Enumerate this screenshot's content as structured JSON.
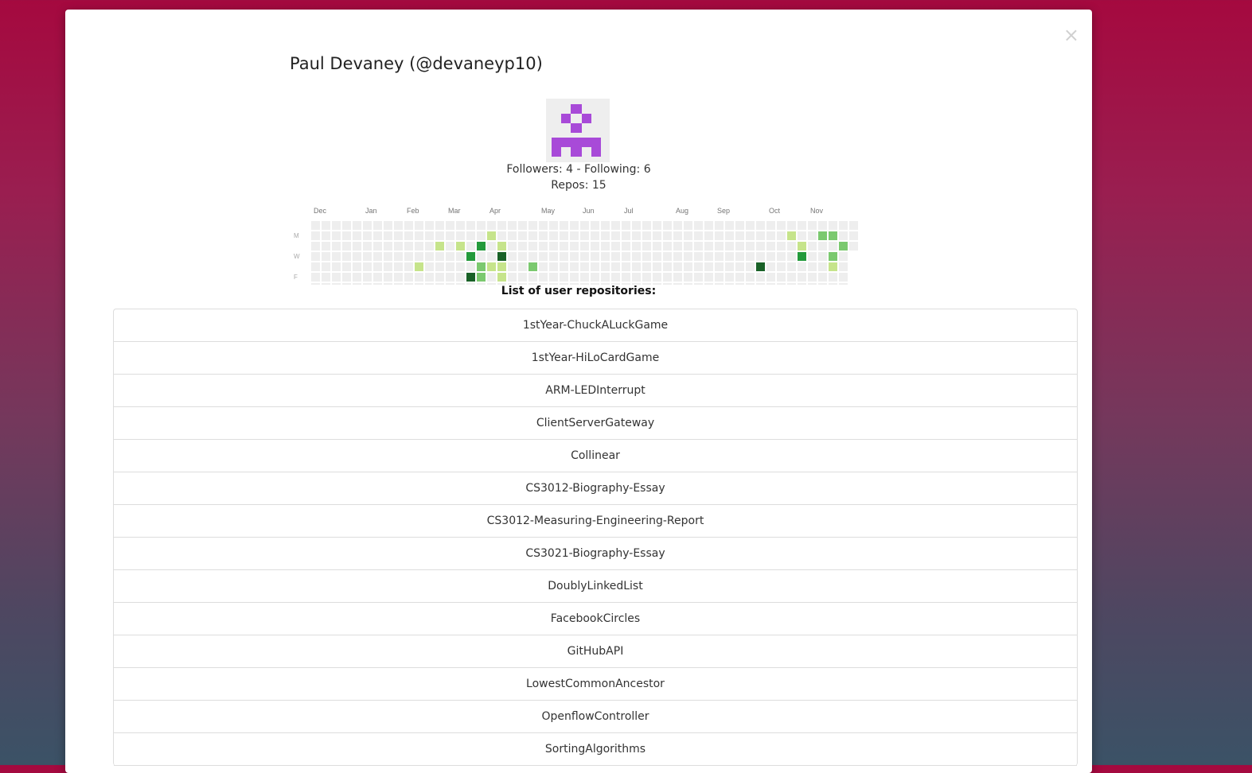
{
  "profile": {
    "title": "Paul Devaney (@devaneyp10)",
    "followers_line": "Followers: 4 - Following: 6",
    "repos_line": "Repos: 15",
    "avatar_color": "#a84ad8"
  },
  "close_icon": "×",
  "calendar": {
    "months": [
      {
        "label": "Dec",
        "week": 1
      },
      {
        "label": "Jan",
        "week": 6
      },
      {
        "label": "Feb",
        "week": 10
      },
      {
        "label": "Mar",
        "week": 14
      },
      {
        "label": "Apr",
        "week": 18
      },
      {
        "label": "May",
        "week": 23
      },
      {
        "label": "Jun",
        "week": 27
      },
      {
        "label": "Jul",
        "week": 31
      },
      {
        "label": "Aug",
        "week": 36
      },
      {
        "label": "Sep",
        "week": 40
      },
      {
        "label": "Oct",
        "week": 45
      },
      {
        "label": "Nov",
        "week": 49
      }
    ],
    "day_labels": [
      {
        "label": "M",
        "row": 1
      },
      {
        "label": "W",
        "row": 3
      },
      {
        "label": "F",
        "row": 5
      }
    ],
    "weeks": 53,
    "colors": [
      "#eeeeee",
      "#c6e48b",
      "#7bc96f",
      "#239a3b",
      "#196127"
    ],
    "active": [
      {
        "week": 17,
        "day": 1,
        "level": 1
      },
      {
        "week": 12,
        "day": 2,
        "level": 1
      },
      {
        "week": 14,
        "day": 2,
        "level": 1
      },
      {
        "week": 16,
        "day": 2,
        "level": 3
      },
      {
        "week": 18,
        "day": 2,
        "level": 1
      },
      {
        "week": 15,
        "day": 3,
        "level": 3
      },
      {
        "week": 18,
        "day": 3,
        "level": 4
      },
      {
        "week": 10,
        "day": 4,
        "level": 1
      },
      {
        "week": 16,
        "day": 4,
        "level": 2
      },
      {
        "week": 17,
        "day": 4,
        "level": 1
      },
      {
        "week": 18,
        "day": 4,
        "level": 1
      },
      {
        "week": 21,
        "day": 4,
        "level": 2
      },
      {
        "week": 15,
        "day": 5,
        "level": 4
      },
      {
        "week": 16,
        "day": 5,
        "level": 2
      },
      {
        "week": 18,
        "day": 5,
        "level": 1
      },
      {
        "week": 46,
        "day": 1,
        "level": 1
      },
      {
        "week": 49,
        "day": 1,
        "level": 2
      },
      {
        "week": 50,
        "day": 1,
        "level": 2
      },
      {
        "week": 47,
        "day": 2,
        "level": 1
      },
      {
        "week": 51,
        "day": 2,
        "level": 2
      },
      {
        "week": 47,
        "day": 3,
        "level": 3
      },
      {
        "week": 50,
        "day": 3,
        "level": 2
      },
      {
        "week": 43,
        "day": 4,
        "level": 4
      },
      {
        "week": 50,
        "day": 4,
        "level": 1
      }
    ]
  },
  "repos_caption": "List of user repositories:",
  "repositories": [
    "1stYear-ChuckALuckGame",
    "1stYear-HiLoCardGame",
    "ARM-LEDInterrupt",
    "ClientServerGateway",
    "Collinear",
    "CS3012-Biography-Essay",
    "CS3012-Measuring-Engineering-Report",
    "CS3021-Biography-Essay",
    "DoublyLinkedList",
    "FacebookCircles",
    "GitHubAPI",
    "LowestCommonAncestor",
    "OpenflowController",
    "SortingAlgorithms"
  ]
}
